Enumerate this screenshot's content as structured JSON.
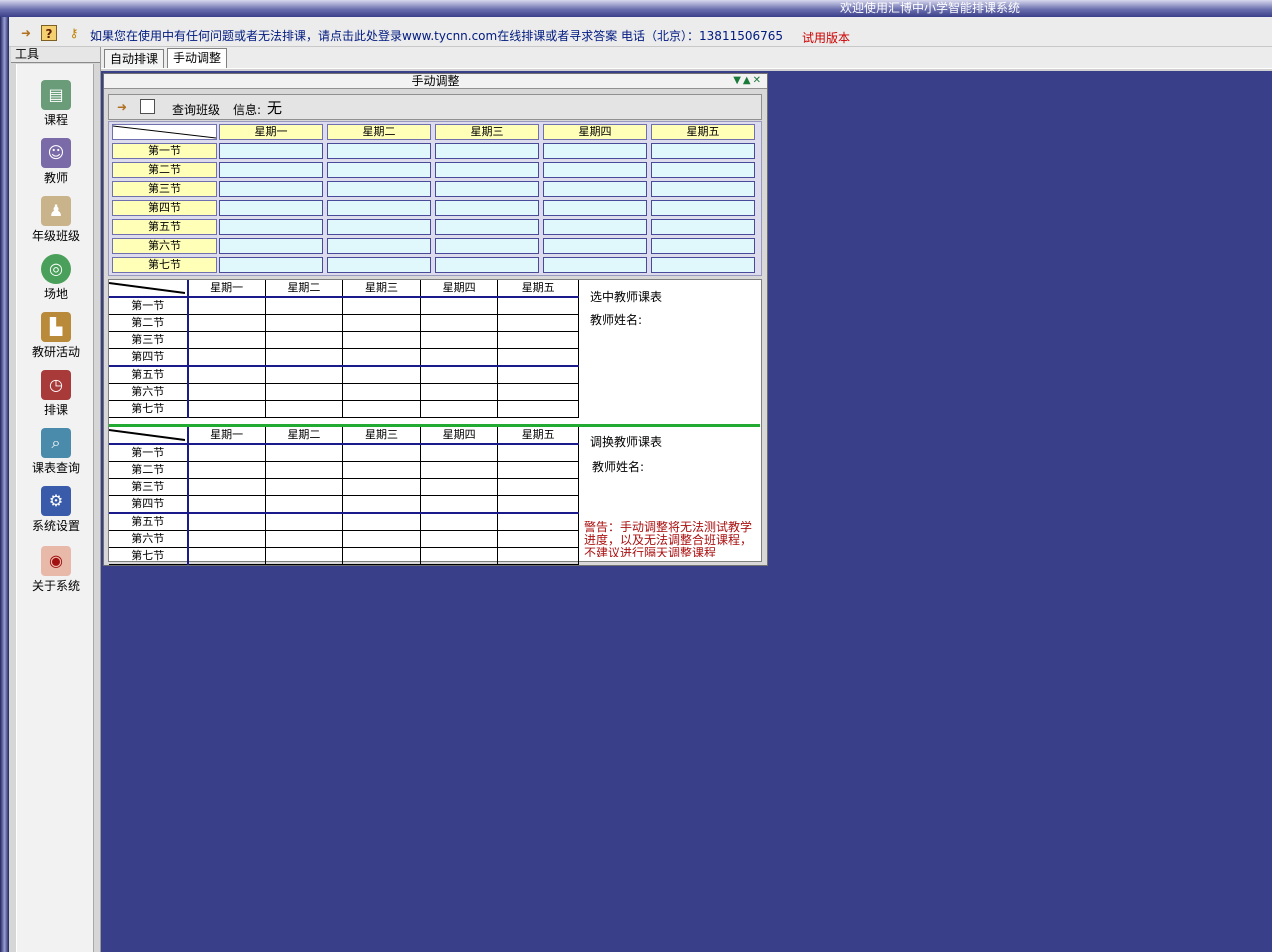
{
  "window": {
    "title": "欢迎使用汇博中小学智能排课系统"
  },
  "toolbar": {
    "icons": [
      "exit-icon",
      "help-icon",
      "key-icon"
    ],
    "notice": "如果您在使用中有任何问题或者无法排课，请点击此处登录www.tycnn.com在线排课或者寻求答案  电话（北京）：13811506765",
    "trial": "试用版本"
  },
  "sidebar": {
    "title": "工具",
    "items": [
      {
        "label": "课程",
        "icon": "course-icon"
      },
      {
        "label": "教师",
        "icon": "teacher-icon"
      },
      {
        "label": "年级班级",
        "icon": "grade-class-icon"
      },
      {
        "label": "场地",
        "icon": "venue-icon"
      },
      {
        "label": "教研活动",
        "icon": "research-activity-icon"
      },
      {
        "label": "排课",
        "icon": "schedule-icon"
      },
      {
        "label": "课表查询",
        "icon": "timetable-search-icon"
      },
      {
        "label": "系统设置",
        "icon": "system-settings-icon"
      },
      {
        "label": "关于系统",
        "icon": "about-icon"
      }
    ]
  },
  "tabs": [
    {
      "label": "自动排课"
    },
    {
      "label": "手动调整",
      "active": true
    }
  ],
  "panel": {
    "title": "手动调整",
    "query_label": "查询班级",
    "info_label": "信息:",
    "info_value": "无"
  },
  "days": [
    "星期一",
    "星期二",
    "星期三",
    "星期四",
    "星期五"
  ],
  "periods": [
    "第一节",
    "第二节",
    "第三节",
    "第四节",
    "第五节",
    "第六节",
    "第七节"
  ],
  "teacher_schedule": {
    "title": "选中教师课表",
    "name_label": "教师姓名:"
  },
  "swap_schedule": {
    "title": "调换教师课表",
    "name_label": "教师姓名:"
  },
  "warning": "警告：手动调整将无法测试教学进度，以及无法调整合班课程，不建议进行隔天调整课程",
  "colors": {
    "desktop": "#3a3f8a",
    "header_cell": "#ffffb8",
    "slot_cell": "#e0f8fc",
    "divider": "#22aa33",
    "trial": "#cc0000",
    "notice": "#001a80"
  }
}
